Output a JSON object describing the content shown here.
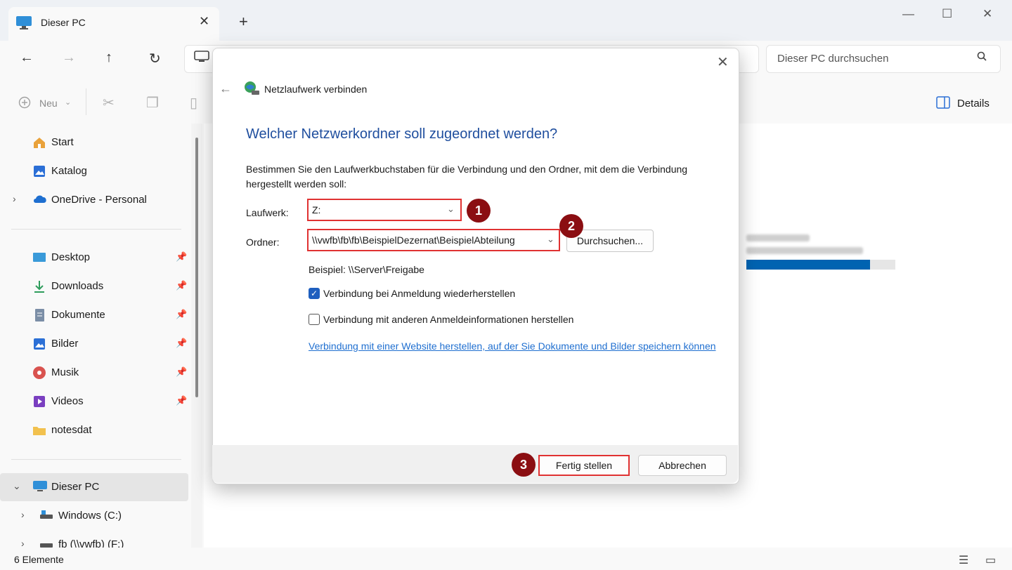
{
  "window": {
    "tab_title": "Dieser PC",
    "tab_close": "✕",
    "new_tab": "+",
    "minimize": "—",
    "maximize": "☐",
    "close": "✕"
  },
  "nav": {
    "back": "←",
    "forward": "→",
    "up": "↑",
    "refresh": "↻",
    "search_placeholder": "Dieser PC durchsuchen"
  },
  "toolbar": {
    "new_label": "Neu",
    "details_label": "Details"
  },
  "sidebar": {
    "quick": [
      {
        "label": "Start",
        "icon": "home-icon",
        "color": "#e9a23b"
      },
      {
        "label": "Katalog",
        "icon": "gallery-icon",
        "color": "#2b6fd6"
      },
      {
        "label": "OneDrive - Personal",
        "icon": "cloud-icon",
        "color": "#1e6fd0"
      }
    ],
    "pinned": [
      {
        "label": "Desktop",
        "icon": "desktop-icon",
        "color": "#3a9ad9"
      },
      {
        "label": "Downloads",
        "icon": "download-icon",
        "color": "#2e9c5c"
      },
      {
        "label": "Dokumente",
        "icon": "document-icon",
        "color": "#7b8ea6"
      },
      {
        "label": "Bilder",
        "icon": "pictures-icon",
        "color": "#2b6fd6"
      },
      {
        "label": "Musik",
        "icon": "music-icon",
        "color": "#d9534f"
      },
      {
        "label": "Videos",
        "icon": "videos-icon",
        "color": "#7a3fc0"
      },
      {
        "label": "notesdat",
        "icon": "folder-icon",
        "color": "#f2c14e"
      }
    ],
    "this_pc": {
      "label": "Dieser PC",
      "icon": "computer-icon"
    },
    "drives": [
      {
        "label": "Windows (C:)",
        "icon": "drive-icon"
      },
      {
        "label": "fb (\\\\vwfb) (F:)",
        "icon": "network-drive-icon"
      }
    ]
  },
  "content": {
    "drive_usage_fraction": 0.83
  },
  "status": {
    "items_count": "6 Elemente"
  },
  "dialog": {
    "wizard_title": "Netzlaufwerk verbinden",
    "heading": "Welcher Netzwerkordner soll zugeordnet werden?",
    "description": "Bestimmen Sie den Laufwerkbuchstaben für die Verbindung und den Ordner, mit dem die Verbindung hergestellt werden soll:",
    "drive_label": "Laufwerk:",
    "drive_value": "Z:",
    "folder_label": "Ordner:",
    "folder_value": "\\\\vwfb\\fb\\fb\\BeispielDezernat\\BeispielAbteilung",
    "browse_button": "Durchsuchen...",
    "example": "Beispiel: \\\\Server\\Freigabe",
    "reconnect_label": "Verbindung bei Anmeldung wiederherstellen",
    "reconnect_checked": true,
    "other_credentials_label": "Verbindung mit anderen Anmeldeinformationen herstellen",
    "other_credentials_checked": false,
    "website_link": "Verbindung mit einer Website herstellen, auf der Sie Dokumente und Bilder speichern können",
    "finish_button": "Fertig stellen",
    "cancel_button": "Abbrechen"
  },
  "annotations": {
    "step1": "1",
    "step2": "2",
    "step3": "3",
    "highlight_color": "#e03232",
    "badge_color": "#8b0e12"
  }
}
